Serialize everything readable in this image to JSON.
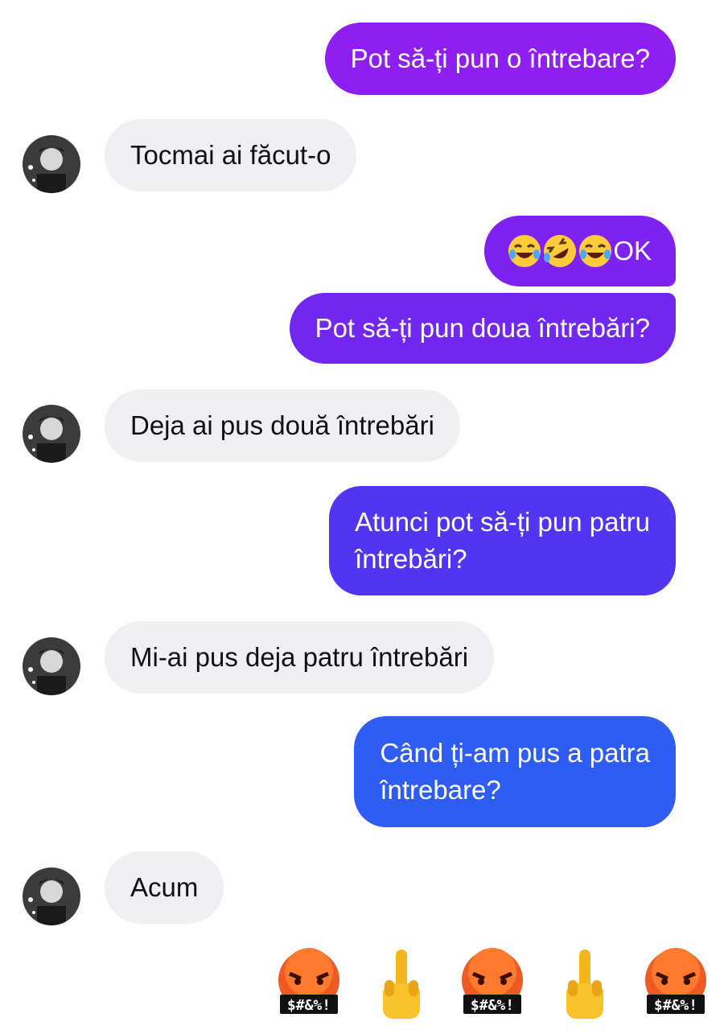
{
  "messages": [
    {
      "dir": "out",
      "text": "Pot să-ți pun o întrebare?"
    },
    {
      "dir": "in",
      "text": "Tocmai ai făcut-o"
    },
    {
      "dir": "out",
      "text": "OK",
      "emoji_prefix": [
        "laughing-tears-icon",
        "rolling-laugh-icon",
        "laughing-tears-icon"
      ]
    },
    {
      "dir": "out",
      "text": "Pot să-ți pun doua întrebări?"
    },
    {
      "dir": "in",
      "text": "Deja ai pus două întrebări"
    },
    {
      "dir": "out",
      "line1": "Atunci pot să-ți pun patru",
      "line2": "întrebări?"
    },
    {
      "dir": "in",
      "text": "Mi-ai pus deja patru întrebări"
    },
    {
      "dir": "out",
      "line1": "Când ți-am pus a patra",
      "line2": "întrebare?"
    },
    {
      "dir": "in",
      "text": "Acum"
    }
  ],
  "reaction_emojis": [
    {
      "icon": "cursing-face-icon",
      "text": "$#&%!"
    },
    {
      "icon": "middle-finger-icon"
    },
    {
      "icon": "cursing-face-icon",
      "text": "$#&%!"
    },
    {
      "icon": "middle-finger-icon"
    },
    {
      "icon": "cursing-face-icon",
      "text": "$#&%!"
    }
  ],
  "colors": {
    "outgoing_top": "#8f1ff0",
    "outgoing_mid": "#6a2df2",
    "outgoing_bottom": "#2f5cf2",
    "incoming_bg": "#f0f0f2"
  }
}
